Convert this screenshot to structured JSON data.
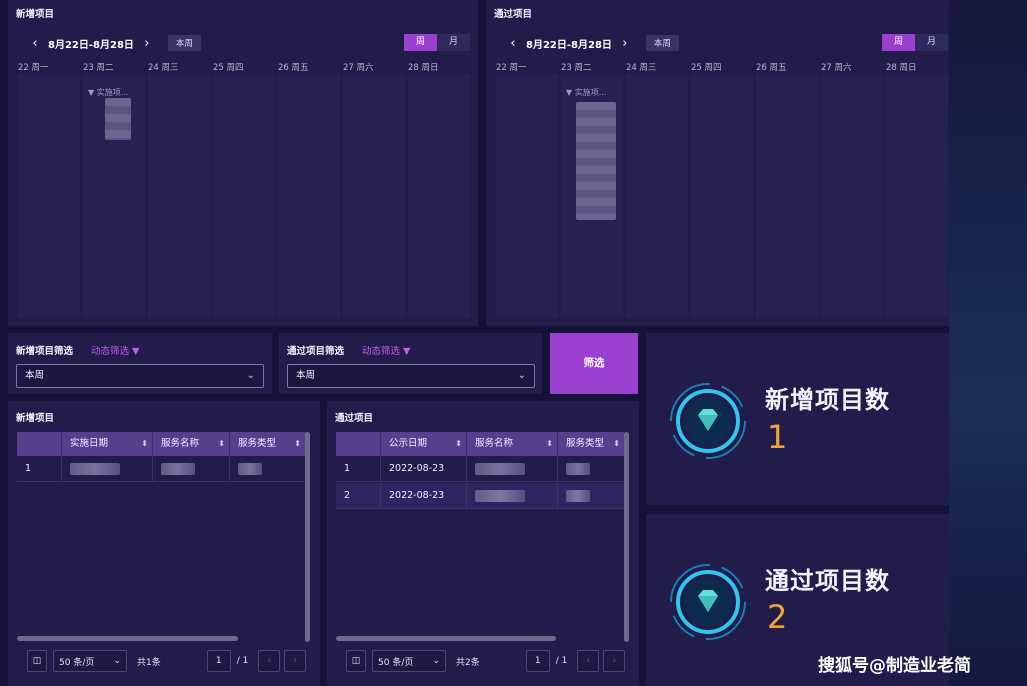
{
  "new_calendar": {
    "title": "新增项目",
    "range": "8月22日-8月28日",
    "this_week": "本周",
    "view_week": "周",
    "view_month": "月",
    "days": [
      "22 周一",
      "23 周二",
      "24 周三",
      "25 周四",
      "26 周五",
      "27 周六",
      "28 周日"
    ],
    "event_label": "▼ 实施项..."
  },
  "passed_calendar": {
    "title": "通过项目",
    "range": "8月22日-8月28日",
    "this_week": "本周",
    "view_week": "周",
    "view_month": "月",
    "days": [
      "22 周一",
      "23 周二",
      "24 周三",
      "25 周四",
      "26 周五",
      "27 周六",
      "28 周日"
    ],
    "event_label": "▼ 实施项..."
  },
  "filters": {
    "new_label": "新增项目筛选",
    "new_dynamic": "动态筛选 ▼",
    "new_value": "本周",
    "passed_label": "通过项目筛选",
    "passed_dynamic": "动态筛选 ▼",
    "passed_value": "本周",
    "button": "筛选"
  },
  "new_table": {
    "title": "新增项目",
    "columns": [
      "",
      "实施日期",
      "服务名称",
      "服务类型"
    ],
    "rows": [
      {
        "index": "1"
      }
    ],
    "page_size": "50 条/页",
    "total": "共1条",
    "page": "1",
    "pages": "/ 1"
  },
  "passed_table": {
    "title": "通过项目",
    "columns": [
      "",
      "公示日期",
      "服务名称",
      "服务类型"
    ],
    "rows": [
      {
        "index": "1",
        "date": "2022-08-23"
      },
      {
        "index": "2",
        "date": "2022-08-23"
      }
    ],
    "page_size": "50 条/页",
    "total": "共2条",
    "page": "1",
    "pages": "/ 1"
  },
  "kpi": {
    "new_label": "新增项目数",
    "new_value": "1",
    "passed_label": "通过项目数",
    "passed_value": "2"
  },
  "watermark": "搜狐号@制造业老简",
  "colors": {
    "accent": "#9b3fd0",
    "kpi_value": "#f1a33a",
    "panel": "#211c4a"
  }
}
